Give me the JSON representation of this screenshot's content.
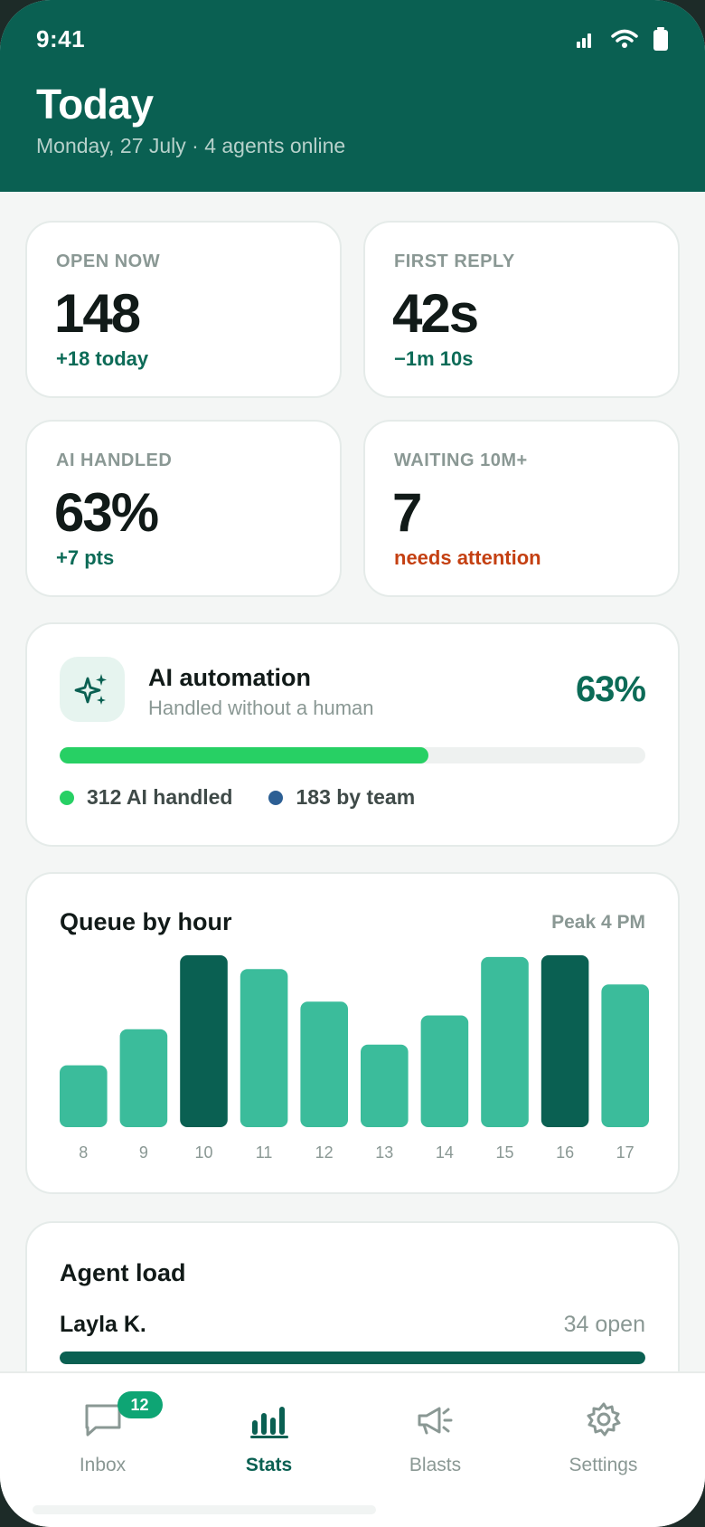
{
  "status_bar": {
    "time": "9:41"
  },
  "header": {
    "title": "Today",
    "subtitle": "Monday, 27 July · 4 agents online"
  },
  "metrics": [
    {
      "label": "OPEN NOW",
      "value": "148",
      "delta": "+18 today",
      "tone": "positive"
    },
    {
      "label": "FIRST REPLY",
      "value": "42s",
      "delta": "−1m 10s",
      "tone": "positive"
    },
    {
      "label": "AI HANDLED",
      "value": "63%",
      "delta": "+7 pts",
      "tone": "positive"
    },
    {
      "label": "WAITING 10M+",
      "value": "7",
      "delta": "needs attention",
      "tone": "warning"
    }
  ],
  "automation": {
    "title": "AI automation",
    "subtitle": "Handled without a human",
    "percent": "63%",
    "progress": 0.63,
    "legend": [
      {
        "label": "312 AI handled",
        "color": "#27d064"
      },
      {
        "label": "183 by team",
        "color": "#2c5f94"
      }
    ]
  },
  "queue": {
    "title": "Queue by hour",
    "peak": "Peak 4 PM"
  },
  "chart_data": {
    "type": "bar",
    "categories": [
      "8",
      "9",
      "10",
      "11",
      "12",
      "13",
      "14",
      "15",
      "16",
      "17"
    ],
    "values": [
      36,
      57,
      100,
      92,
      73,
      48,
      65,
      99,
      100,
      83
    ],
    "highlighted": [
      "10",
      "16"
    ],
    "colors": {
      "normal": "#3bbc9b",
      "highlight": "#0a6052"
    },
    "title": "Queue by hour",
    "xlabel": "",
    "ylabel": "",
    "ylim": [
      0,
      100
    ],
    "grid": false
  },
  "agent_load": {
    "title": "Agent load",
    "agents": [
      {
        "name": "Layla K.",
        "open": "34 open",
        "load": 1.0
      }
    ]
  },
  "tabbar": {
    "tabs": [
      {
        "label": "Inbox",
        "icon": "chat-bubble-icon",
        "badge": "12"
      },
      {
        "label": "Stats",
        "icon": "bar-chart-icon",
        "active": true
      },
      {
        "label": "Blasts",
        "icon": "megaphone-icon"
      },
      {
        "label": "Settings",
        "icon": "gear-icon"
      }
    ]
  }
}
